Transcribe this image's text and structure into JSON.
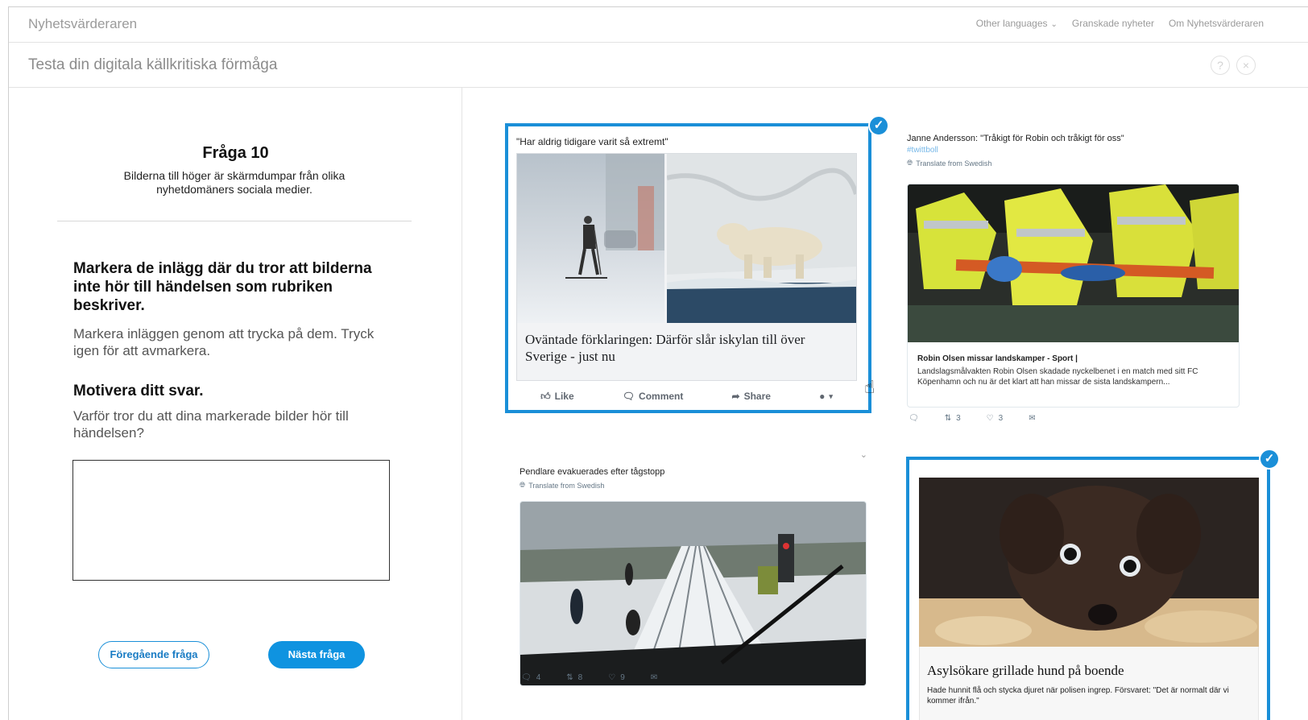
{
  "app": {
    "brand": "Nyhetsvärderaren",
    "nav": [
      "Other languages",
      "Granskade nyheter",
      "Om Nyhetsvärderaren"
    ],
    "subtitle": "Testa din digitala källkritiska förmåga",
    "help_label": "?",
    "close_label": "×"
  },
  "question": {
    "title": "Fråga 10",
    "description": "Bilderna till höger är skärmdumpar från olika nyhetdomäners sociala medier.",
    "instruction_part1": "Markera de inlägg där du tror att bilderna ",
    "instruction_bold": "inte hör till",
    "instruction_part2": " händelsen som rubriken beskriver.",
    "instruction_sub": "Markera inläggen genom att trycka på dem. Tryck igen för att avmarkera.",
    "motivate_title": "Motivera ditt svar.",
    "motivate_question": "Varför tror du att dina markerade bilder hör till händelsen?",
    "answer_value": "",
    "prev_button": "Föregående fråga",
    "next_button": "Nästa fråga"
  },
  "posts": {
    "facebook": {
      "selected": true,
      "headline": "\"Har aldrig tidigare varit så extremt\"",
      "link_title": "Oväntade förklaringen: Därför slår iskylan till över Sverige - just nu",
      "like": "Like",
      "comment": "Comment",
      "share": "Share"
    },
    "tweet_hockey": {
      "selected": false,
      "author": "Janne Andersson: \"Tråkigt för Robin och tråkigt för oss\"",
      "hashtag": "#twittboll",
      "translate": "Translate from Swedish",
      "media_title": "Robin Olsen missar landskamper - Sport |",
      "media_desc": "Landslagsmålvakten Robin Olsen skadade nyckelbenet i en match med sitt FC Köpenhamn och nu är det klart att han missar de sista landskampern...",
      "retweets": "3",
      "likes": "3"
    },
    "tweet_train": {
      "selected": false,
      "headline": "Pendlare evakuerades efter tågstopp",
      "translate": "Translate from Swedish",
      "replies": "4",
      "retweets": "8",
      "likes": "9"
    },
    "dog": {
      "selected": true,
      "title": "Asylsökare grillade hund på boende",
      "desc": "Hade hunnit flå och stycka djuret när polisen ingrep. Försvaret: \"Det är normalt där vi kommer ifrån.\""
    }
  },
  "colors": {
    "accent": "#1a8fd8",
    "button_primary": "#0f93e0",
    "muted_text": "#8c8c8c"
  }
}
